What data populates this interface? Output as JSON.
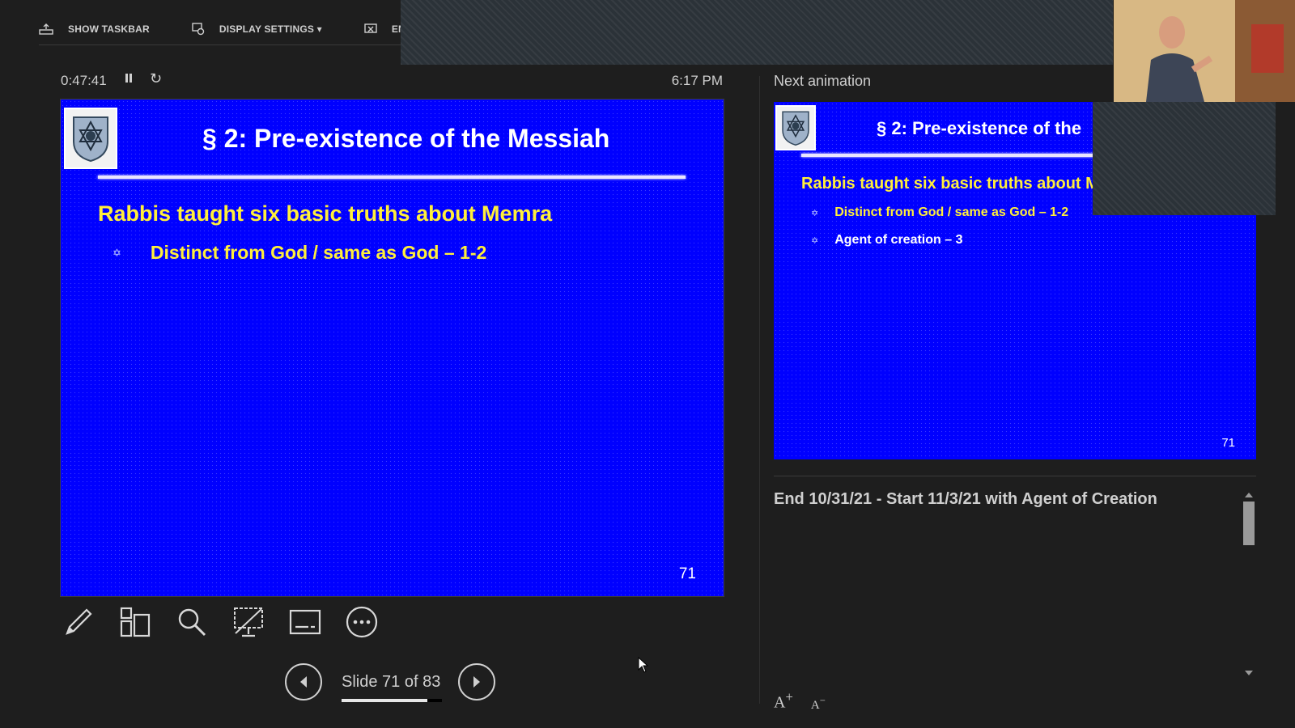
{
  "topbar": {
    "show_taskbar": "SHOW TASKBAR",
    "display_settings": "DISPLAY SETTINGS ▾",
    "end_slide_show": "EN"
  },
  "status": {
    "timer": "0:47:41",
    "pause_icon": "pause-icon",
    "restart_icon": "restart-icon",
    "clock": "6:17 PM"
  },
  "current_slide": {
    "title": "§ 2: Pre-existence of the Messiah",
    "heading": "Rabbis taught six basic truths about Memra",
    "bullets": [
      "Distinct from God / same as God – 1-2"
    ],
    "number": "71",
    "logo": "lion-star-shield-logo"
  },
  "next_panel": {
    "label": "Next animation",
    "slide": {
      "title": "§ 2: Pre-existence of the",
      "heading": "Rabbis taught six basic truths about M",
      "bullets": [
        "Distinct from God / same as God – 1-2",
        "Agent of creation – 3"
      ],
      "number": "71"
    }
  },
  "notes": {
    "text": "End 10/31/21 - Start 11/3/21 with Agent of Creation"
  },
  "font_controls": {
    "larger": "A",
    "smaller": "A"
  },
  "tools": [
    "pen-icon",
    "see-all-slides-icon",
    "zoom-icon",
    "black-screen-icon",
    "subtitles-icon",
    "more-options-icon"
  ],
  "navigation": {
    "counter": "Slide 71 of 83",
    "progress": 0.855
  },
  "colors": {
    "background": "#1e1e1e",
    "slide_blue": "#0000ff",
    "slide_yellow": "#ffef3b",
    "text": "#cfcfcf"
  }
}
